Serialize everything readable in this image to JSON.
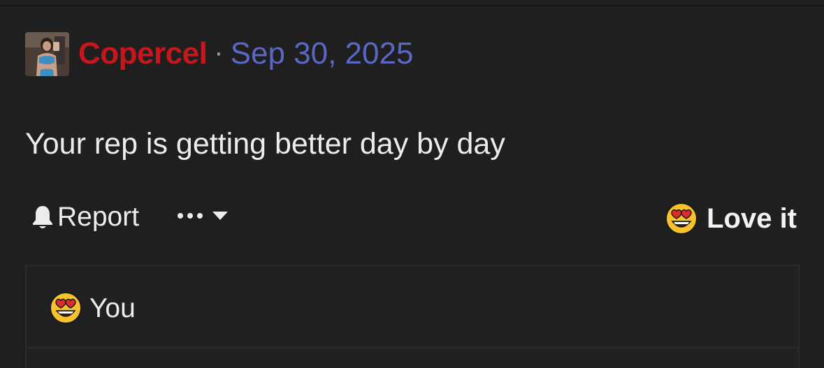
{
  "post": {
    "author": "Copercel",
    "separator": "·",
    "date": "Sep 30, 2025",
    "body": "Your rep is getting better day by day"
  },
  "actions": {
    "report_label": "Report",
    "reaction_label": "Love it",
    "reaction_icon": "heart-eyes-emoji-icon"
  },
  "reactions": {
    "items": [
      {
        "icon": "heart-eyes-emoji-icon",
        "name": "You"
      }
    ]
  },
  "colors": {
    "background": "#1f1f1f",
    "username": "#c8161d",
    "date": "#5a68c4",
    "text": "#ececec",
    "panel_border": "#2b2b2b"
  }
}
